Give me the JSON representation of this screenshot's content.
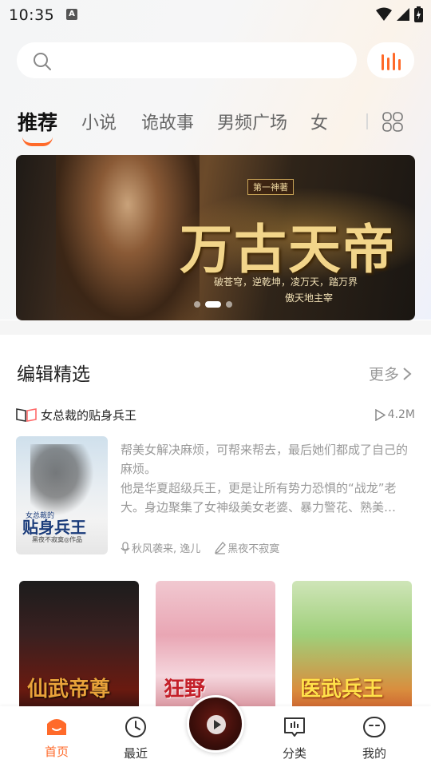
{
  "status_bar": {
    "time": "10:35",
    "notification_icon": "A"
  },
  "search": {
    "placeholder": ""
  },
  "tabs": [
    {
      "label": "推荐",
      "active": true
    },
    {
      "label": "小说"
    },
    {
      "label": "诡故事"
    },
    {
      "label": "男频广场"
    },
    {
      "label": "女"
    }
  ],
  "banner": {
    "title": "万古天帝",
    "tag": "第一神著",
    "subtitle_1": "破苍穹，逆乾坤，凌万天，踏万界",
    "subtitle_2": "傲天地主宰",
    "active_dot": 1,
    "dot_count": 3
  },
  "editor_picks": {
    "title": "编辑精选",
    "more_label": "更多",
    "featured": {
      "title": "女总裁的贴身兵王",
      "plays": "4.2M",
      "description": "帮美女解决麻烦，可帮来帮去，最后她们都成了自己的麻烦。\n他是华夏超级兵王，更是让所有势力恐惧的“战龙”老大。身边聚集了女神级美女老婆、暴力警花、熟美…",
      "narrator": "秋风袭来, 逸儿",
      "author": "黑夜不寂寞",
      "cover_small": "女总裁的",
      "cover_title": "贴身兵王",
      "cover_author": "黑夜不寂寞◎作品"
    },
    "covers": [
      {
        "title": "仙武帝尊"
      },
      {
        "title": "狂野"
      },
      {
        "title": "医武兵王"
      }
    ]
  },
  "bottom_nav": [
    {
      "label": "首页",
      "icon": "home-icon",
      "active": true
    },
    {
      "label": "最近",
      "icon": "clock-icon"
    },
    {
      "label": "分类",
      "icon": "category-icon"
    },
    {
      "label": "我的",
      "icon": "profile-icon"
    }
  ],
  "colors": {
    "accent": "#ff6a2a",
    "text_primary": "#222222",
    "text_secondary": "#999999"
  }
}
